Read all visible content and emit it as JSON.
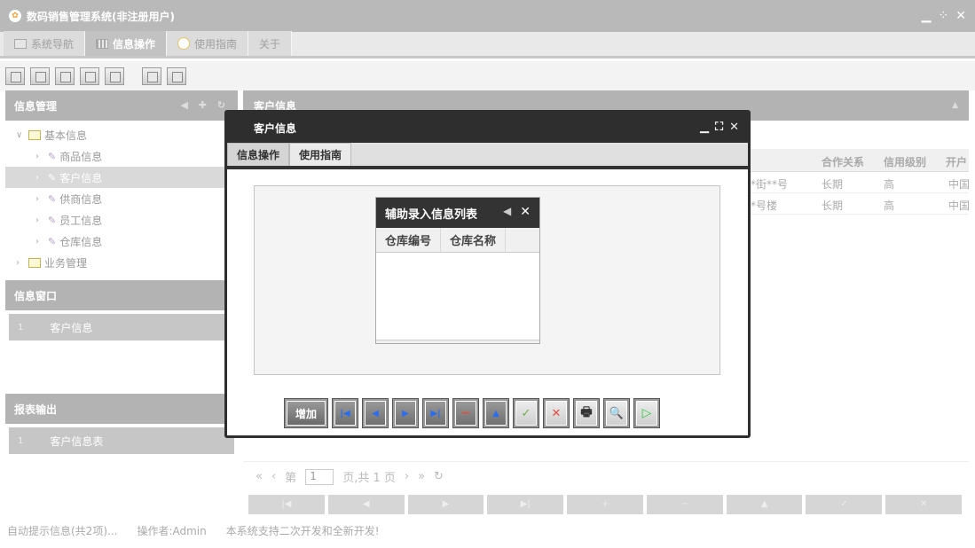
{
  "app": {
    "title": "数码销售管理系统(非注册用户)"
  },
  "menu": [
    {
      "label": "系统导航",
      "icon": "monitor-icon"
    },
    {
      "label": "信息操作",
      "icon": "grid-icon",
      "active": true
    },
    {
      "label": "使用指南",
      "icon": "circle-icon"
    },
    {
      "label": "关于",
      "icon": ""
    }
  ],
  "sidebar": {
    "info_header": "信息管理",
    "tree": [
      {
        "label": "基本信息",
        "level": 1,
        "type": "folder"
      },
      {
        "label": "商品信息",
        "level": 2
      },
      {
        "label": "客户信息",
        "level": 2,
        "selected": true
      },
      {
        "label": "供商信息",
        "level": 2
      },
      {
        "label": "员工信息",
        "level": 2
      },
      {
        "label": "仓库信息",
        "level": 2
      },
      {
        "label": "业务管理",
        "level": 1,
        "type": "folder"
      }
    ],
    "window_header": "信息窗口",
    "window_items": [
      {
        "index": "1",
        "label": "客户信息"
      }
    ],
    "report_header": "报表输出",
    "report_items": [
      {
        "index": "1",
        "label": "客户信息表"
      }
    ]
  },
  "main": {
    "title": "客户信息",
    "columns": [
      "合作关系",
      "信用级别",
      "开户"
    ],
    "rows": [
      {
        "address": "**街**号",
        "relation": "长期",
        "credit": "高",
        "bank": "中国"
      },
      {
        "address": "**号楼",
        "relation": "长期",
        "credit": "高",
        "bank": "中国"
      }
    ],
    "pager": {
      "prefix": "第",
      "page": "1",
      "suffix": "页,共 1 页"
    },
    "bottom_buttons": [
      "|◀",
      "◀",
      "▶",
      "▶|",
      "+",
      "−",
      "▲",
      "✓",
      "✕"
    ]
  },
  "status": {
    "hint": "自动提示信息(共2项)...",
    "operator": "操作者:Admin",
    "note": "本系统支持二次开发和全新开发!"
  },
  "modal": {
    "title": "客户信息",
    "tabs": [
      "信息操作",
      "使用指南"
    ],
    "popup": {
      "title": "辅助录入信息列表",
      "columns": [
        "仓库编号",
        "仓库名称"
      ]
    },
    "toolbar": {
      "add_label": "增加",
      "nav_first": "|◀",
      "nav_prev": "◀",
      "nav_next": "▶",
      "nav_last": "▶|",
      "delete": "−",
      "up": "▲",
      "confirm": "✓",
      "cancel": "✕",
      "print": "🖶",
      "preview": "🔍",
      "run": "▷"
    }
  }
}
